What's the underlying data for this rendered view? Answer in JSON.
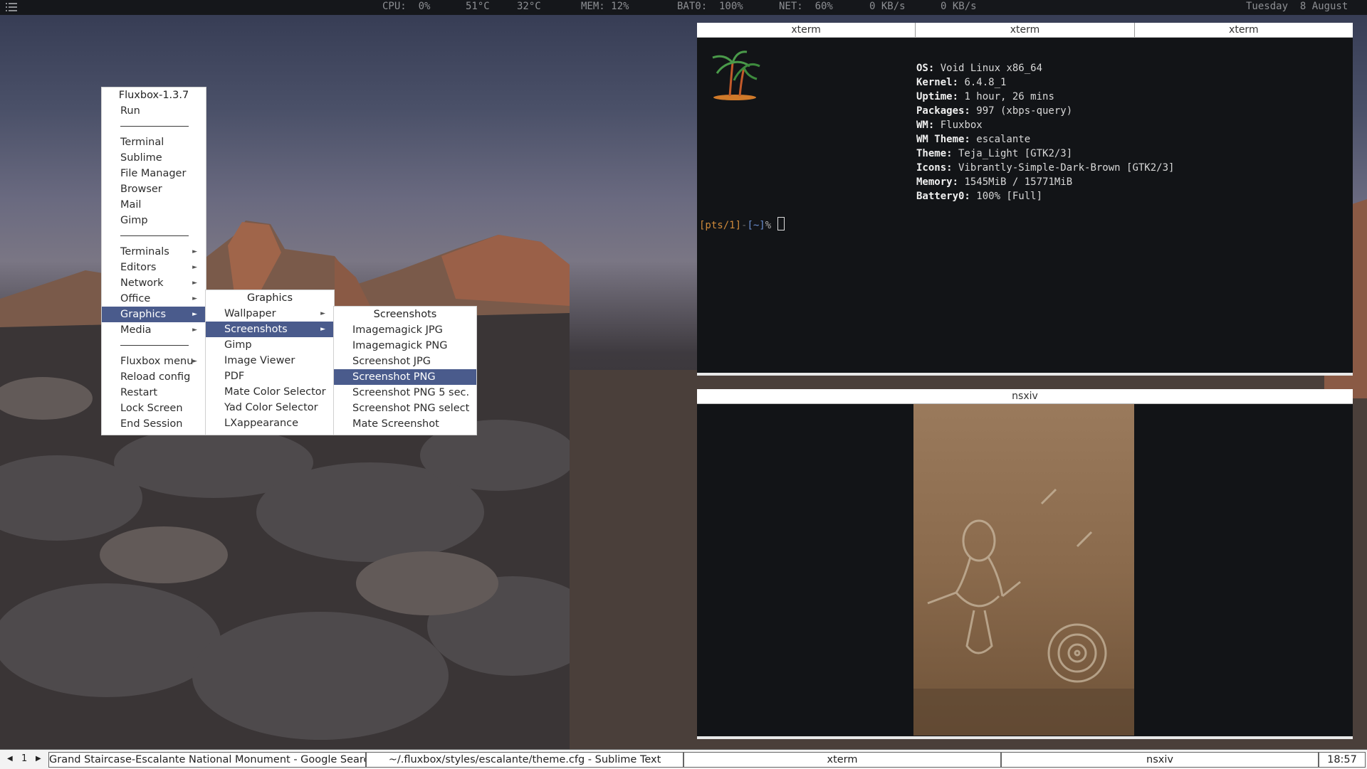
{
  "topbar": {
    "cpu": "CPU:  0%",
    "temp1": "51°C",
    "temp2": "32°C",
    "mem": "MEM: 12%",
    "bat": "BAT0:  100%",
    "net": "NET:  60%",
    "down": "0 KB/s",
    "up": "0 KB/s",
    "date": "Tuesday  8 August"
  },
  "menu_main": {
    "title": "Fluxbox-1.3.7",
    "items": [
      "Run",
      "Terminal",
      "Sublime",
      "File Manager",
      "Browser",
      "Mail",
      "Gimp",
      "Terminals",
      "Editors",
      "Network",
      "Office",
      "Graphics",
      "Media",
      "Fluxbox menu",
      "Reload config",
      "Restart",
      "Lock Screen",
      "End Session"
    ]
  },
  "menu_graphics": {
    "title": "Graphics",
    "items": [
      "Wallpaper",
      "Screenshots",
      "Gimp",
      "Image Viewer",
      "PDF",
      "Mate Color Selector",
      "Yad Color Selector",
      "LXappearance"
    ]
  },
  "menu_screenshots": {
    "title": "Screenshots",
    "items": [
      "Imagemagick JPG",
      "Imagemagick PNG",
      "Screenshot JPG",
      "Screenshot PNG",
      "Screenshot PNG 5 sec.",
      "Screenshot PNG select",
      "Mate Screenshot"
    ]
  },
  "xterm": {
    "tabs": [
      "xterm",
      "xterm",
      "xterm"
    ],
    "fetch": [
      {
        "key": "OS:",
        "value": " Void Linux x86_64"
      },
      {
        "key": "Kernel:",
        "value": " 6.4.8_1"
      },
      {
        "key": "Uptime:",
        "value": " 1 hour, 26 mins"
      },
      {
        "key": "Packages:",
        "value": " 997 (xbps-query)"
      },
      {
        "key": "WM:",
        "value": " Fluxbox"
      },
      {
        "key": "WM Theme:",
        "value": " escalante"
      },
      {
        "key": "Theme:",
        "value": " Teja_Light [GTK2/3]"
      },
      {
        "key": "Icons:",
        "value": " Vibrantly-Simple-Dark-Brown [GTK2/3]"
      },
      {
        "key": "Memory:",
        "value": " 1545MiB / 15771MiB"
      },
      {
        "key": "Battery0:",
        "value": " 100% [Full]"
      }
    ],
    "prompt_pts": "[pts/1]",
    "prompt_sep": "-",
    "prompt_dir": "[~]",
    "prompt_sym": "%"
  },
  "nsxiv": {
    "title": "nsxiv"
  },
  "taskbar": {
    "workspace": "1",
    "tasks": [
      "Grand Staircase-Escalante National Monument - Google Search",
      "~/.fluxbox/styles/escalante/theme.cfg - Sublime Text",
      "xterm",
      "nsxiv"
    ],
    "clock": "18:57"
  },
  "colors": {
    "menu_selected": "#4a5b8c",
    "prompt_orange": "#d08a3a",
    "prompt_blue": "#6a8fd0"
  }
}
